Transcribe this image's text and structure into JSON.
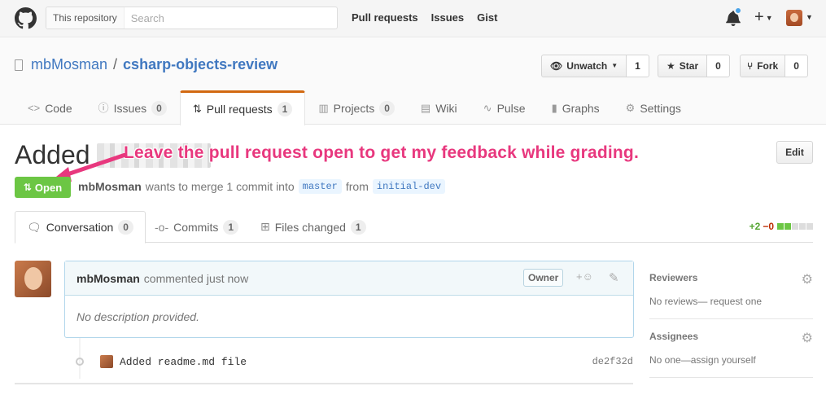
{
  "header": {
    "search_scope": "This repository",
    "search_placeholder": "Search",
    "nav": [
      "Pull requests",
      "Issues",
      "Gist"
    ]
  },
  "repo": {
    "owner": "mbMosman",
    "separator": "/",
    "name": "csharp-objects-review",
    "watch": {
      "label": "Unwatch",
      "count": "1"
    },
    "star": {
      "label": "Star",
      "count": "0"
    },
    "fork": {
      "label": "Fork",
      "count": "0"
    },
    "tabs": [
      {
        "label": "Code",
        "icon": "code-icon"
      },
      {
        "label": "Issues",
        "icon": "issue-icon",
        "count": "0"
      },
      {
        "label": "Pull requests",
        "icon": "pull-request-icon",
        "count": "1"
      },
      {
        "label": "Projects",
        "icon": "project-icon",
        "count": "0"
      },
      {
        "label": "Wiki",
        "icon": "book-icon"
      },
      {
        "label": "Pulse",
        "icon": "pulse-icon"
      },
      {
        "label": "Graphs",
        "icon": "graph-icon"
      },
      {
        "label": "Settings",
        "icon": "gear-icon"
      }
    ]
  },
  "pr": {
    "title": "Added",
    "annotation": "Leave the pull request open to get my feedback while grading.",
    "edit_label": "Edit",
    "state": "Open",
    "author": "mbMosman",
    "merge_text": "wants to merge 1 commit into",
    "base_branch": "master",
    "from_text": "from",
    "head_branch": "initial-dev",
    "tabs": [
      {
        "label": "Conversation",
        "count": "0"
      },
      {
        "label": "Commits",
        "count": "1"
      },
      {
        "label": "Files changed",
        "count": "1"
      }
    ],
    "diffstat": {
      "additions": "+2",
      "deletions": "−0"
    }
  },
  "comment": {
    "author": "mbMosman",
    "action": "commented just now",
    "badge": "Owner",
    "body": "No description provided."
  },
  "commit": {
    "message": "Added readme.md file",
    "sha": "de2f32d"
  },
  "sidebar": {
    "reviewers": {
      "heading": "Reviewers",
      "text": "No reviews— request one"
    },
    "assignees": {
      "heading": "Assignees",
      "text": "No one—assign yourself"
    }
  },
  "colors": {
    "accent_tab": "#d26911",
    "open_state": "#6cc644",
    "link": "#4078c0",
    "annotation": "#e8387e"
  }
}
